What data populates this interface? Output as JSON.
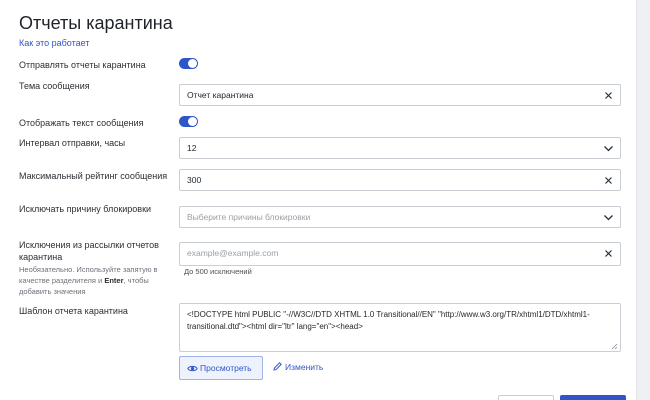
{
  "page": {
    "title": "Отчеты карантина",
    "help_link": "Как это работает"
  },
  "send_reports": {
    "label": "Отправлять отчеты карантина",
    "enabled": true
  },
  "subject": {
    "label": "Тема сообщения",
    "value": "Отчет карантина",
    "icon": "clear-icon"
  },
  "show_text": {
    "label": "Отображать текст сообщения",
    "enabled": true
  },
  "interval": {
    "label": "Интервал отправки, часы",
    "value": "12",
    "icon": "chevron-down-icon"
  },
  "max_rating": {
    "label": "Максимальный рейтинг сообщения",
    "value": "300",
    "icon": "clear-icon"
  },
  "block_reason": {
    "label": "Исключать причину блокировки",
    "placeholder": "Выберите причины блокировки",
    "icon": "chevron-down-icon"
  },
  "exclusions": {
    "label": "Исключения из рассылки отчетов карантина",
    "hint_before": "Необязательно. Используйте запятую в качестве разделителя и ",
    "hint_key": "Enter",
    "hint_after": ", чтобы добавить значения",
    "placeholder": "example@example.com",
    "limit_note": "До 500 исключений",
    "icon": "clear-icon"
  },
  "template": {
    "label": "Шаблон отчета карантина",
    "value": "<!DOCTYPE html PUBLIC \"-//W3C//DTD XHTML 1.0 Transitional//EN\" \"http://www.w3.org/TR/xhtml1/DTD/xhtml1-transitional.dtd\"><html dir=\"ltr\" lang=\"en\"><head>",
    "preview_label": "Просмотреть",
    "edit_label": "Изменить"
  },
  "colors": {
    "accent": "#2f56c8",
    "border": "#c9cdd4",
    "background": "#e9ebef"
  }
}
